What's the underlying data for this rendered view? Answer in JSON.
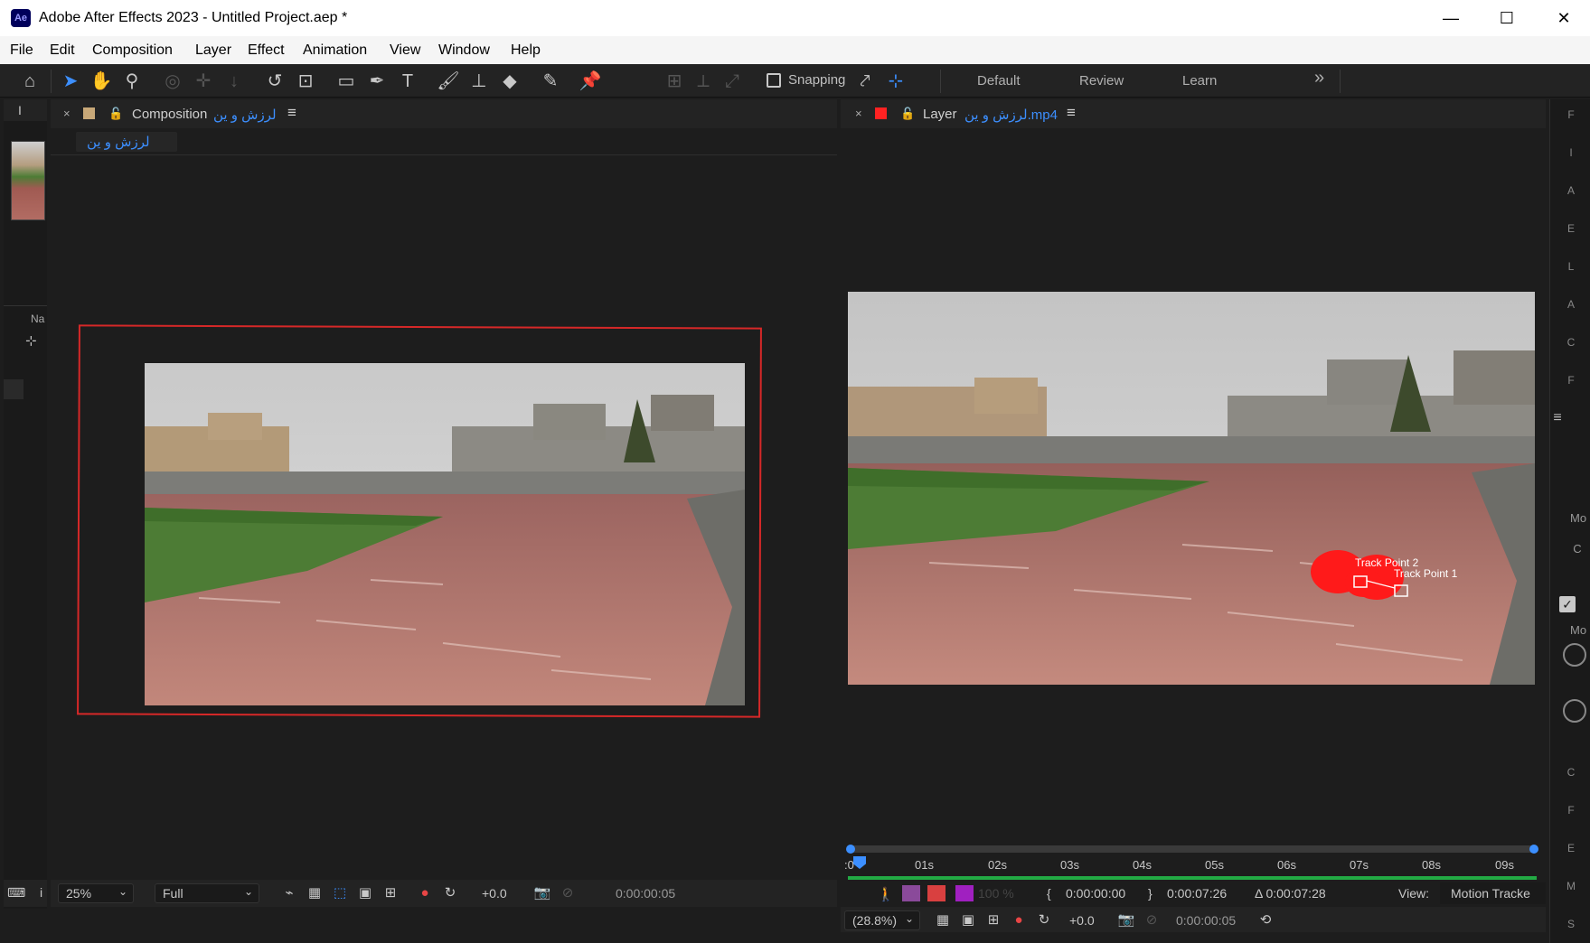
{
  "window": {
    "app_icon": "Ae",
    "title": "Adobe After Effects 2023 - Untitled Project.aep *",
    "minimize": "—",
    "maximize": "☐",
    "close": "✕"
  },
  "menu": [
    "File",
    "Edit",
    "Composition",
    "Layer",
    "Effect",
    "Animation",
    "View",
    "Window",
    "Help"
  ],
  "toolbar": {
    "snapping_label": "Snapping",
    "workspaces": [
      "Default",
      "Review",
      "Learn"
    ],
    "more": "»"
  },
  "project_panel": {
    "tab": "I",
    "name_col": "Na"
  },
  "comp_panel": {
    "close": "×",
    "prefix": "Composition",
    "name": "لرزش و ین",
    "tab_label": "لرزش و ین",
    "zoom": "25%",
    "resolution": "Full",
    "exposure": "+0.0",
    "timecode": "0:00:00:05"
  },
  "layer_panel": {
    "close": "×",
    "prefix": "Layer",
    "name": "لرزش و ین.mp4",
    "track_point_1": "Track Point 1",
    "track_point_2": "Track Point 2",
    "ruler_labels": [
      ":0",
      "01s",
      "02s",
      "03s",
      "04s",
      "05s",
      "06s",
      "07s",
      "08s",
      "09s"
    ],
    "opacity": "100 %",
    "in_point": "0:00:00:00",
    "out_point": "0:00:07:26",
    "duration": "Δ 0:00:07:28",
    "view_label": "View:",
    "view_value": "Motion Tracke",
    "zoom": "(28.8%)",
    "exposure": "+0.0",
    "timecode": "0:00:00:05"
  },
  "right_strip": [
    "F",
    "I",
    "A",
    "E",
    "L",
    "A",
    "C",
    "F",
    "≡",
    "Mo",
    "C",
    "Mo",
    "C",
    "F",
    "E",
    "M",
    "S"
  ],
  "colors": {
    "accent": "#3c8fff",
    "comp_border": "#d62828",
    "layer_label": "#ff2222",
    "track_green": "#22aa44"
  }
}
